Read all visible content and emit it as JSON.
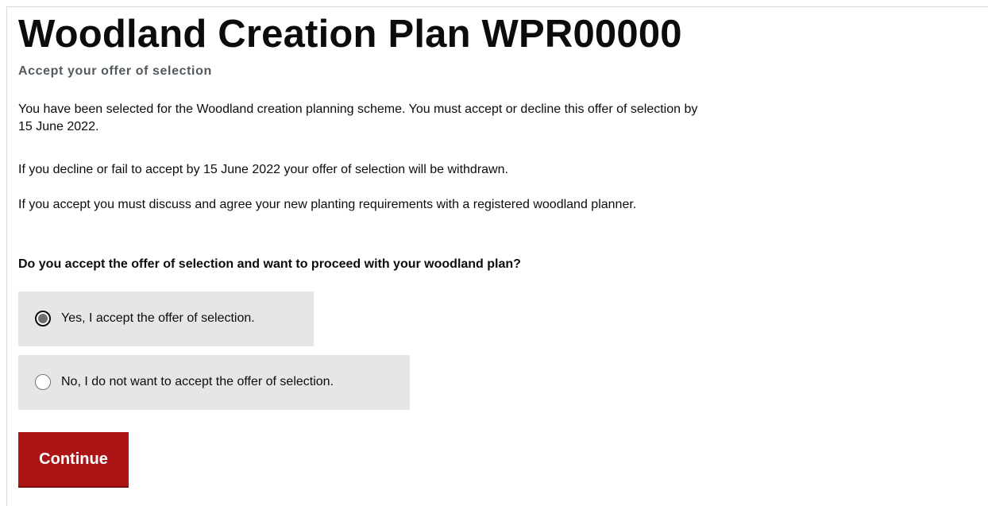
{
  "page": {
    "title": "Woodland Creation Plan WPR00000",
    "subtitle": "Accept your offer of selection",
    "paragraphs": [
      "You have been selected for the Woodland creation planning scheme. You must accept or decline this offer of selection by 15 June 2022.",
      "If you decline or fail to accept by 15 June 2022 your offer of selection will be withdrawn.",
      "If you accept you must discuss and agree your new planting requirements with a registered woodland planner."
    ],
    "question": "Do you accept the offer of selection and want to proceed with your woodland plan?"
  },
  "form": {
    "options": [
      {
        "label": "Yes, I accept the offer of selection.",
        "selected": true
      },
      {
        "label": "No, I do not want to accept the offer of selection.",
        "selected": false
      }
    ],
    "continue_label": "Continue"
  },
  "colors": {
    "button_background": "#ab1515",
    "option_background": "#e6e6e6",
    "text": "#0b0c0c",
    "subtitle_text": "#505a5f"
  }
}
